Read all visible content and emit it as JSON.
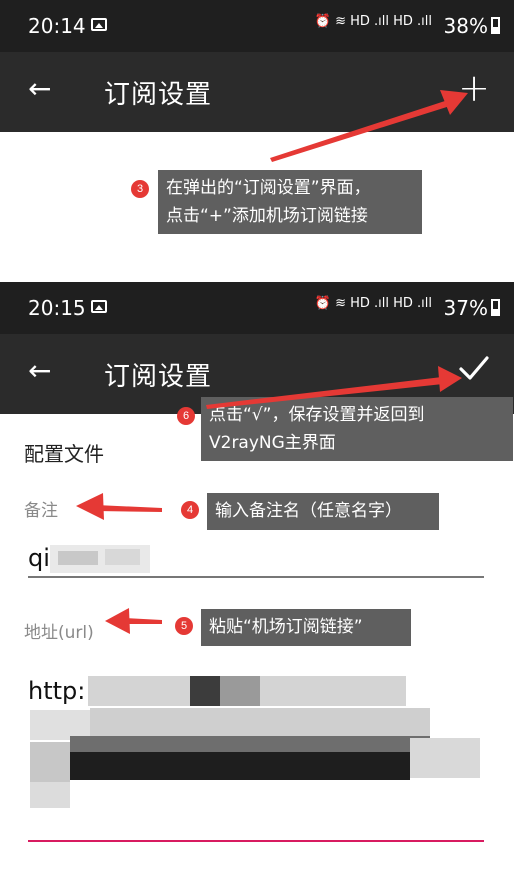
{
  "top": {
    "status": {
      "time": "20:14",
      "network": "⏰ ≋ HD .ıll HD .ıll",
      "battery": "38%"
    },
    "toolbar": {
      "back_icon": "←",
      "title": "订阅设置",
      "action_icon": "+"
    }
  },
  "bottom": {
    "status": {
      "time": "20:15",
      "network": "⏰ ≋ HD .ıll HD .ıll",
      "battery": "37%"
    },
    "toolbar": {
      "back_icon": "←",
      "title": "订阅设置"
    },
    "form": {
      "section_title": "配置文件",
      "remarks_label": "备注",
      "remarks_value": "qi",
      "url_label": "地址(url)",
      "url_value": "http:"
    }
  },
  "annotations": [
    {
      "number": "3",
      "text_line1": "在弹出的“订阅设置”界面，",
      "text_line2": "点击“+”添加机场订阅链接"
    },
    {
      "number": "6",
      "text_line1": "点击“√”，保存设置并返回到",
      "text_line2": "V2rayNG主界面"
    },
    {
      "number": "4",
      "text_line1": "输入备注名（任意名字）"
    },
    {
      "number": "5",
      "text_line1": "粘贴“机场订阅链接”"
    }
  ],
  "colors": {
    "toolbar": "#2b2b2b",
    "statusbar": "#1f1f1f",
    "callout": "#5f5f5f",
    "arrow": "#e53935",
    "accent_underline": "#d81b60"
  }
}
